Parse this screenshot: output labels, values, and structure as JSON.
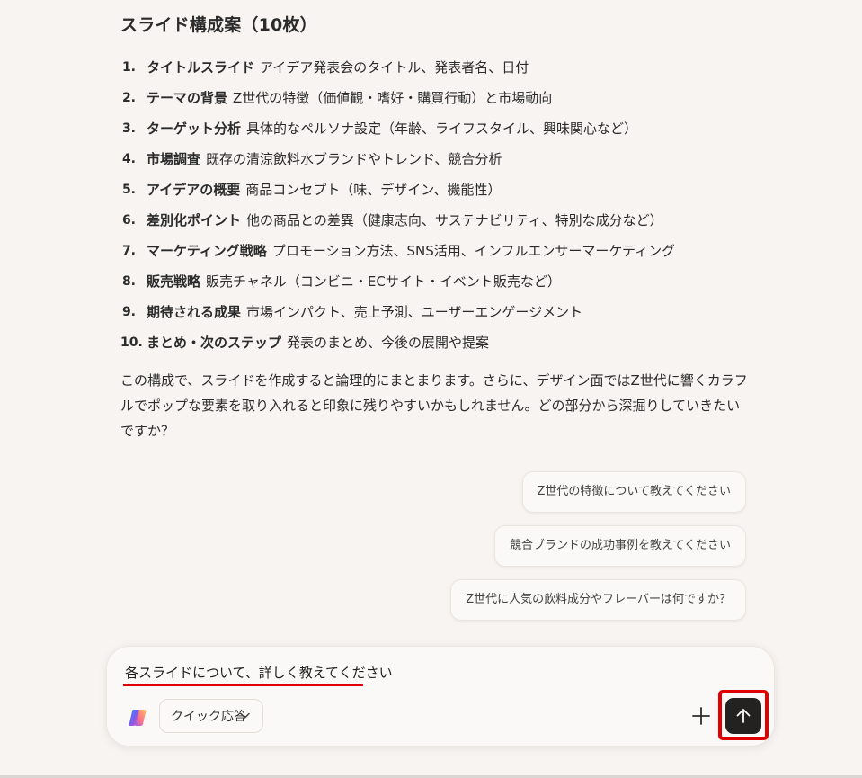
{
  "response": {
    "heading": "スライド構成案（10枚）",
    "slides": [
      {
        "number": "1.",
        "title": "タイトルスライド",
        "description": "アイデア発表会のタイトル、発表者名、日付"
      },
      {
        "number": "2.",
        "title": "テーマの背景",
        "description": "Z世代の特徴（価値観・嗜好・購買行動）と市場動向"
      },
      {
        "number": "3.",
        "title": "ターゲット分析",
        "description": "具体的なペルソナ設定（年齢、ライフスタイル、興味関心など）"
      },
      {
        "number": "4.",
        "title": "市場調査",
        "description": "既存の清涼飲料水ブランドやトレンド、競合分析"
      },
      {
        "number": "5.",
        "title": "アイデアの概要",
        "description": "商品コンセプト（味、デザイン、機能性）"
      },
      {
        "number": "6.",
        "title": "差別化ポイント",
        "description": "他の商品との差異（健康志向、サステナビリティ、特別な成分など）"
      },
      {
        "number": "7.",
        "title": "マーケティング戦略",
        "description": "プロモーション方法、SNS活用、インフルエンサーマーケティング"
      },
      {
        "number": "8.",
        "title": "販売戦略",
        "description": "販売チャネル（コンビニ・ECサイト・イベント販売など）"
      },
      {
        "number": "9.",
        "title": "期待される成果",
        "description": "市場インパクト、売上予測、ユーザーエンゲージメント"
      },
      {
        "number": "10.",
        "title": "まとめ・次のステップ",
        "description": "発表のまとめ、今後の展開や提案"
      }
    ],
    "summary": "この構成で、スライドを作成すると論理的にまとまります。さらに、デザイン面ではZ世代に響くカラフルでポップな要素を取り入れると印象に残りやすいかもしれません。どの部分から深掘りしていきたいですか？"
  },
  "suggestions": [
    "Z世代の特徴について教えてください",
    "競合ブランドの成功事例を教えてください",
    "Z世代に人気の飲料成分やフレーバーは何ですか？"
  ],
  "composer": {
    "input_value": "各スライドについて、詳しく教えてください",
    "mode_label": "クイック応答",
    "icons": {
      "app": "copilot-logo-icon",
      "mode": "chevron-down-icon",
      "attach": "plus-icon",
      "send": "arrow-up-icon"
    },
    "highlight_color": "#e00000",
    "send_color": "#232221"
  }
}
